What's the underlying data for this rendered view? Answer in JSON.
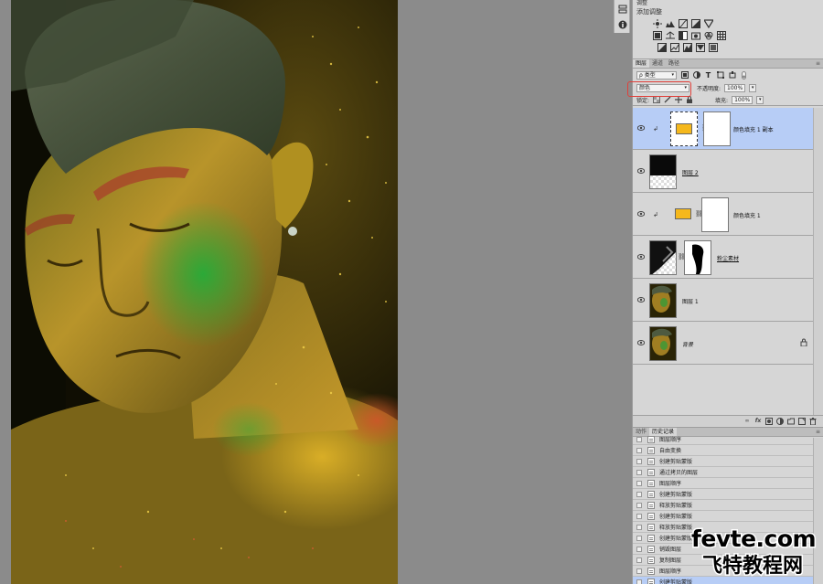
{
  "adjustments": {
    "header": "调整",
    "title": "添加调整"
  },
  "layers_panel": {
    "tabs": [
      "图层",
      "通道",
      "路径"
    ],
    "filter_kind": "ρ 类型",
    "blend_mode": "颜色",
    "opacity_label": "不透明度:",
    "opacity_value": "100%",
    "lock_label": "锁定:",
    "fill_label": "填充:",
    "fill_value": "100%",
    "layers": [
      {
        "name": "颜色填充 1 副本",
        "selected": true,
        "type": "fill",
        "clipped": true
      },
      {
        "name": "图层 2",
        "selected": false,
        "type": "pixel",
        "clipped": false
      },
      {
        "name": "颜色填充 1",
        "selected": false,
        "type": "fill",
        "clipped": true
      },
      {
        "name": "粉尘素材",
        "selected": false,
        "type": "pixel-mask",
        "clipped": false
      },
      {
        "name": "图层 1",
        "selected": false,
        "type": "photo",
        "clipped": false
      },
      {
        "name": "背景",
        "selected": false,
        "type": "photo",
        "clipped": false,
        "locked": true
      }
    ],
    "fill_color": "#f5b81c"
  },
  "history_panel": {
    "tabs": [
      "动作",
      "历史记录"
    ],
    "items": [
      "图层顺序",
      "自由变换",
      "创建剪贴蒙版",
      "通过拷贝的图层",
      "图层顺序",
      "创建剪贴蒙版",
      "释放剪贴蒙版",
      "创建剪贴蒙版",
      "释放剪贴蒙版",
      "创建剪贴蒙版",
      "销毁图层",
      "复制图层",
      "图层顺序",
      "创建剪贴蒙版"
    ],
    "selected_index": 13
  },
  "watermark": {
    "line1": "fevte.com",
    "line2": "飞特教程网"
  },
  "icons": {
    "eye": "eye-icon",
    "chain": "chain-link-icon",
    "lock": "lock-icon"
  }
}
